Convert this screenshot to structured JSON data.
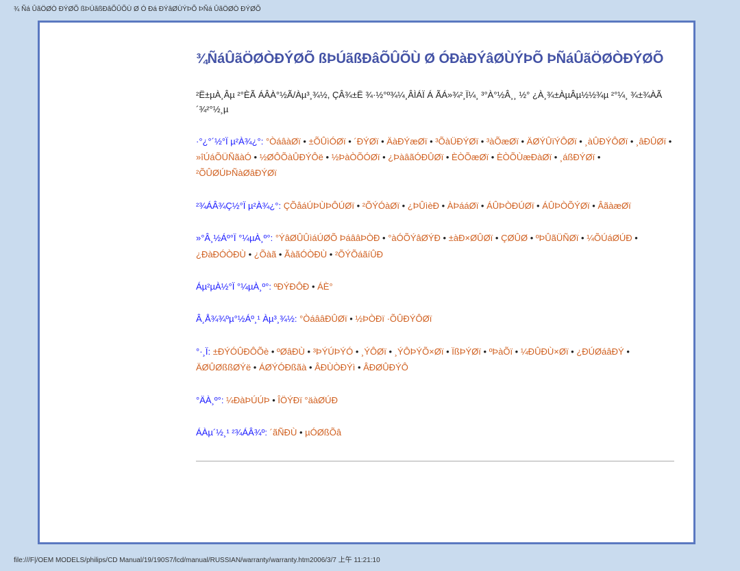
{
  "urlTop": "¾ Ñá ÛãÖØÒ ÐÝØÕ ßÞÚãßÐâÕÛÕÙ Ø Ó Ðá ÐÝâØÙÝÞÕ ÞÑá ÛãÖØÒ ÐÝØÕ",
  "heading": "¾ÑáÛãÖØÒÐÝØÕ ßÞÚãßÐâÕÛÕÙ Ø ÓÐàÐÝâØÙÝÞÕ ÞÑáÛãÖØÒÐÝØÕ",
  "intro": "²Ë±µÀ¸Âµ ²°ÈÃ ÁÂÀ°½Ã/Àµ³¸¾½, ÇÂ¾±Ë ¾·½°º¾¼¸ÂÌÁÏ Á ÃÁ»¾²¸Ï¼¸ ³°À°½Â¸¸ ½° ¿À¸¾±ÀµÂµ½½¾µ ²°¼¸ ¾±¾ÀÃ´¾²°½¸µ",
  "blocks": [
    {
      "label": "·°¿°´½°Ï µ²À¾¿°: ",
      "items": "°ÒáâàØï • ±ÕÛìÓØï • ´ÐÝØï • ÄàÐÝæØï • ³ÕàÜÐÝØï • ³àÕæØï • ÄØÝÛïÝÔØï • ¸àÛÐÝÔØï • ¸âÐÛØï • »îÚáÕÜÑãàÓ • ½ØÔÕàÛÐÝÔë • ½ÞàÒÕÓØï • ¿ÞàâãÓÐÛØï • ÈÒÕæØï • ÈÒÕÙæÐàØï • ¸áßÐÝØï • ²ÕÛØÚÞÑàØâÐÝØï"
    },
    {
      "label": "²¾ÁÂ¾Ç½°Ï µ²À¾¿°: ",
      "items": "ÇÕåáÚÞÙÞÔÚØï • ²ÕÝÓàØï • ¿ÞÛìèÐ • ÀÞááØï • ÁÛÞÒÐÚØï • ÁÛÞÒÕÝØï • ÂãàæØï"
    },
    {
      "label": "»°Â¸½Áº°Ï °¼µÀ¸º°: ",
      "items": "°ÝâØÛÛìáÚØÕ ÞáââÞÒÐ • °àÓÕÝâØÝÐ • ±àÐ×ØÛØï • ÇØÛØ • ºÞÛãÜÑØï • ¼ÕÚáØÚÐ • ¿ÐàÐÓÒÐÙ • ¿Õàã • ÃàãÓÒÐÙ • ²ÕÝÕáãíÛÐ"
    },
    {
      "label": "Áµ²µÀ½°Ï °¼µÀ¸º°: ",
      "items": "ºÐÝÐÔÐ • ÁÈ°"
    },
    {
      "label": "Â¸Å¾¾ºµ°½Áº¸¹ Àµ³¸¾½: ",
      "items": "°ÒáââÐÛØï • ½ÞÒÐï ·ÕÛÐÝÔØï"
    },
    {
      "label": "°·¸Ï: ",
      "items": "±ÐÝÓÛÐÔÕè • ºØâÐÙ • ³ÞÝÚÞÝÓ • ¸ÝÔØï • ¸ÝÔÞÝÕ×Øï • ÏßÞÝØï • ºÞàÕï • ¼ÐÛÐÙ×Øï • ¿ÐÚØáâÐÝ • ÄØÛØßßØÝë • ÁØÝÓÐßãà • ÂÐÙÒÐÝì • ÂÐØÛÐÝÔ"
    },
    {
      "label": "°ÄÀ¸º°: ",
      "items": "¼ÐàÞÚÚÞ • ÎÖÝÐï °äàØÚÐ"
    },
    {
      "label": "ÁÀµ´½¸¹ ²¾ÁÂ¾º: ",
      "items": "´ãÑÐÙ • µÓØßÕâ"
    }
  ],
  "footerUrl": "file:///F|/OEM MODELS/philips/CD Manual/19/190S7/lcd/manual/RUSSIAN/warranty/warranty.htm2006/3/7 上午 11:21:10"
}
